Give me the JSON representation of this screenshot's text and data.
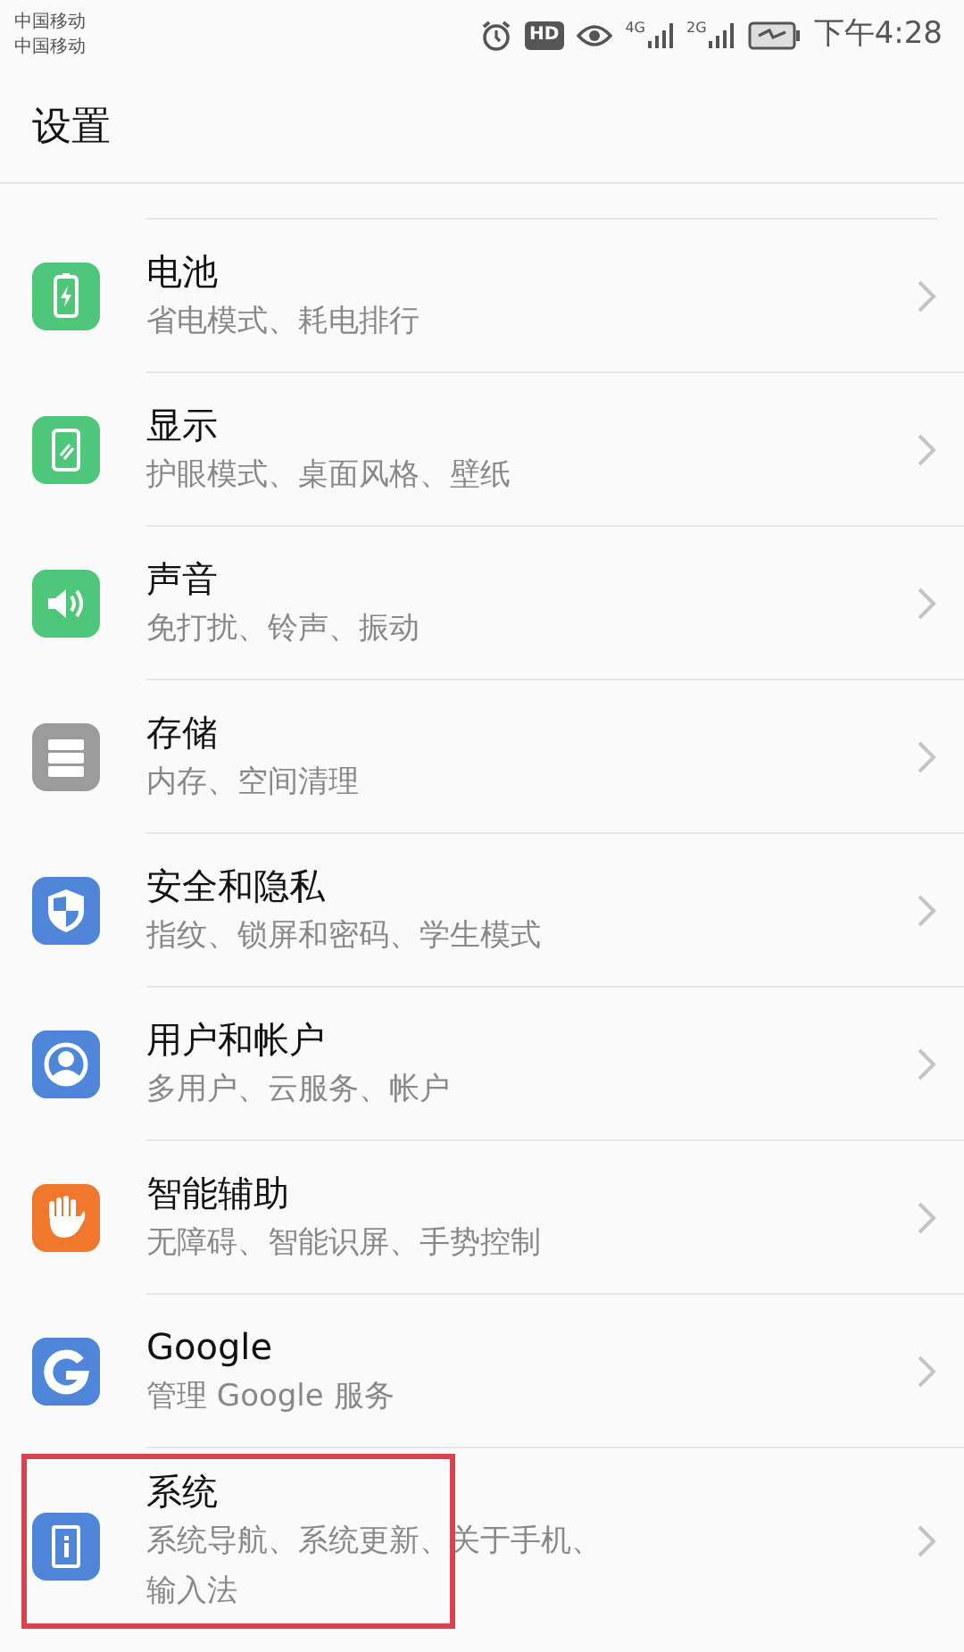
{
  "status_bar": {
    "carriers": [
      "中国移动",
      "中国移动"
    ],
    "hd_label": "HD",
    "networks": [
      "4G",
      "2G"
    ],
    "time": "下午4:28"
  },
  "header": {
    "title": "设置"
  },
  "items": [
    {
      "kind": "battery",
      "color": "#4fc77a",
      "title": "电池",
      "subtitle_lines": [
        "省电模式、耗电排行"
      ],
      "highlighted": false
    },
    {
      "kind": "display",
      "color": "#4fc77a",
      "title": "显示",
      "subtitle_lines": [
        "护眼模式、桌面风格、壁纸"
      ],
      "highlighted": false
    },
    {
      "kind": "sound",
      "color": "#4fc77a",
      "title": "声音",
      "subtitle_lines": [
        "免打扰、铃声、振动"
      ],
      "highlighted": false
    },
    {
      "kind": "storage",
      "color": "#9b9b9b",
      "title": "存储",
      "subtitle_lines": [
        "内存、空间清理"
      ],
      "highlighted": false
    },
    {
      "kind": "shield",
      "color": "#4f86d9",
      "title": "安全和隐私",
      "subtitle_lines": [
        "指纹、锁屏和密码、学生模式"
      ],
      "highlighted": false
    },
    {
      "kind": "user",
      "color": "#4f86d9",
      "title": "用户和帐户",
      "subtitle_lines": [
        "多用户、云服务、帐户"
      ],
      "highlighted": false
    },
    {
      "kind": "hand",
      "color": "#f0782c",
      "title": "智能辅助",
      "subtitle_lines": [
        "无障碍、智能识屏、手势控制"
      ],
      "highlighted": false
    },
    {
      "kind": "google",
      "color": "#4f86d9",
      "title": "Google",
      "subtitle_lines": [
        "管理 Google 服务"
      ],
      "highlighted": false
    },
    {
      "kind": "info",
      "color": "#4f86d9",
      "title": "系统",
      "subtitle_lines": [
        "系统导航、系统更新、关于手机、",
        "输入法"
      ],
      "highlighted": true
    }
  ]
}
